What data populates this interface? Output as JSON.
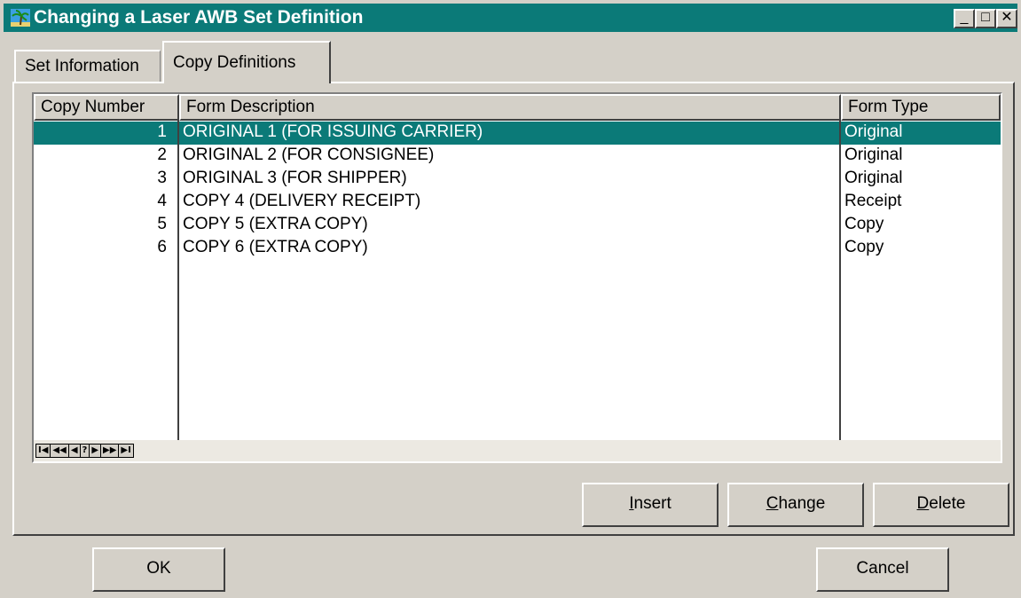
{
  "window": {
    "title": "Changing a Laser AWB Set Definition",
    "accent_color": "#0b7a78",
    "icon": "palm-tree-app-icon",
    "controls": {
      "minimize": "_",
      "maximize": "□",
      "close": "✕"
    }
  },
  "tabs": [
    {
      "label": "Set Information",
      "active": false
    },
    {
      "label": "Copy Definitions",
      "active": true
    }
  ],
  "grid": {
    "columns": [
      "Copy Number",
      "Form Description",
      "Form Type"
    ],
    "rows": [
      {
        "num": "1",
        "desc": "ORIGINAL 1 (FOR ISSUING CARRIER)",
        "type": "Original",
        "selected": true
      },
      {
        "num": "2",
        "desc": "ORIGINAL 2  (FOR CONSIGNEE)",
        "type": "Original",
        "selected": false
      },
      {
        "num": "3",
        "desc": "ORIGINAL 3  (FOR SHIPPER)",
        "type": "Original",
        "selected": false
      },
      {
        "num": "4",
        "desc": "COPY 4 (DELIVERY RECEIPT)",
        "type": "Receipt",
        "selected": false
      },
      {
        "num": "5",
        "desc": "COPY 5 (EXTRA COPY)",
        "type": "Copy",
        "selected": false
      },
      {
        "num": "6",
        "desc": "COPY 6 (EXTRA COPY)",
        "type": "Copy",
        "selected": false
      }
    ],
    "nav_buttons": [
      "I◀",
      "◀◀",
      "◀",
      "?",
      "▶",
      "▶▶",
      "▶I"
    ]
  },
  "buttons": {
    "insert": {
      "mnemonic": "I",
      "rest": "nsert"
    },
    "change": {
      "mnemonic": "C",
      "rest": "hange"
    },
    "delete": {
      "mnemonic": "D",
      "rest": "elete"
    },
    "ok": "OK",
    "cancel": "Cancel"
  }
}
